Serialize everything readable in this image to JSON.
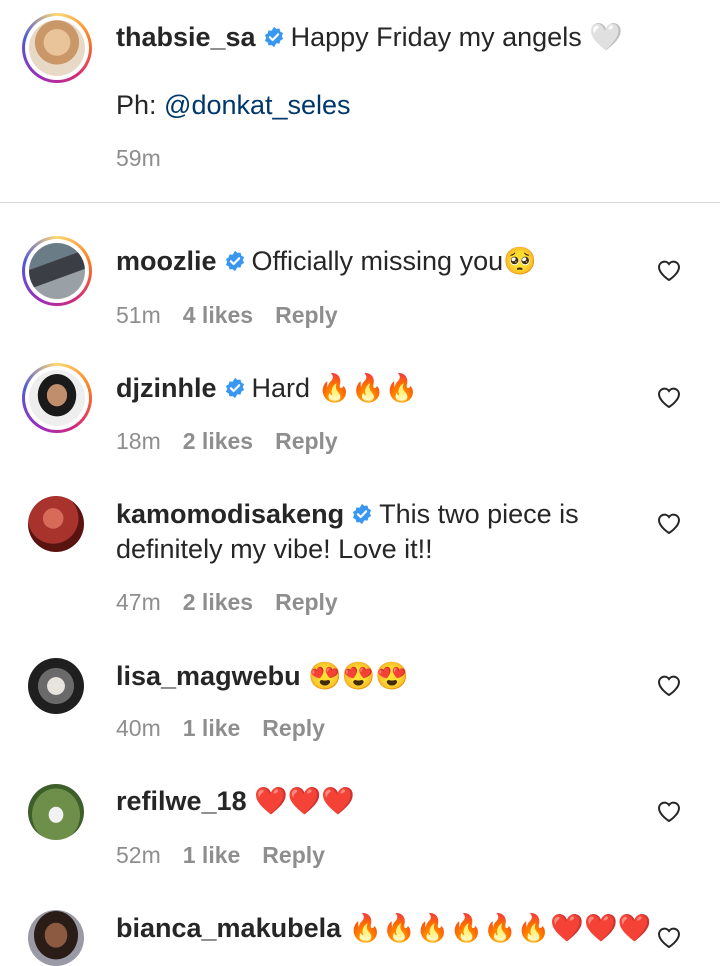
{
  "caption": {
    "username": "thabsie_sa",
    "text": "Happy Friday my angels 🤍",
    "line2_prefix": "Ph: ",
    "mention": "@donkat_seles",
    "time": "59m"
  },
  "comments": [
    {
      "username": "moozlie",
      "text": "Officially missing you🥺",
      "time": "51m",
      "likes": "4 likes",
      "reply": "Reply"
    },
    {
      "username": "djzinhle",
      "text": "Hard 🔥🔥🔥",
      "time": "18m",
      "likes": "2 likes",
      "reply": "Reply"
    },
    {
      "username": "kamomodisakeng",
      "text": "This two piece is",
      "text_line2": "definitely my vibe! Love it!!",
      "time": "47m",
      "likes": "2 likes",
      "reply": "Reply"
    },
    {
      "username": "lisa_magwebu",
      "text": "😍😍😍",
      "time": "40m",
      "likes": "1 like",
      "reply": "Reply"
    },
    {
      "username": "refilwe_18",
      "text": "❤️❤️❤️",
      "time": "52m",
      "likes": "1 like",
      "reply": "Reply"
    },
    {
      "username": "bianca_makubela",
      "text": "🔥🔥🔥🔥🔥🔥❤️❤️❤️"
    }
  ],
  "colors": {
    "verified": "#3897f0",
    "mention": "#00376b",
    "meta": "#8e8e8e"
  }
}
